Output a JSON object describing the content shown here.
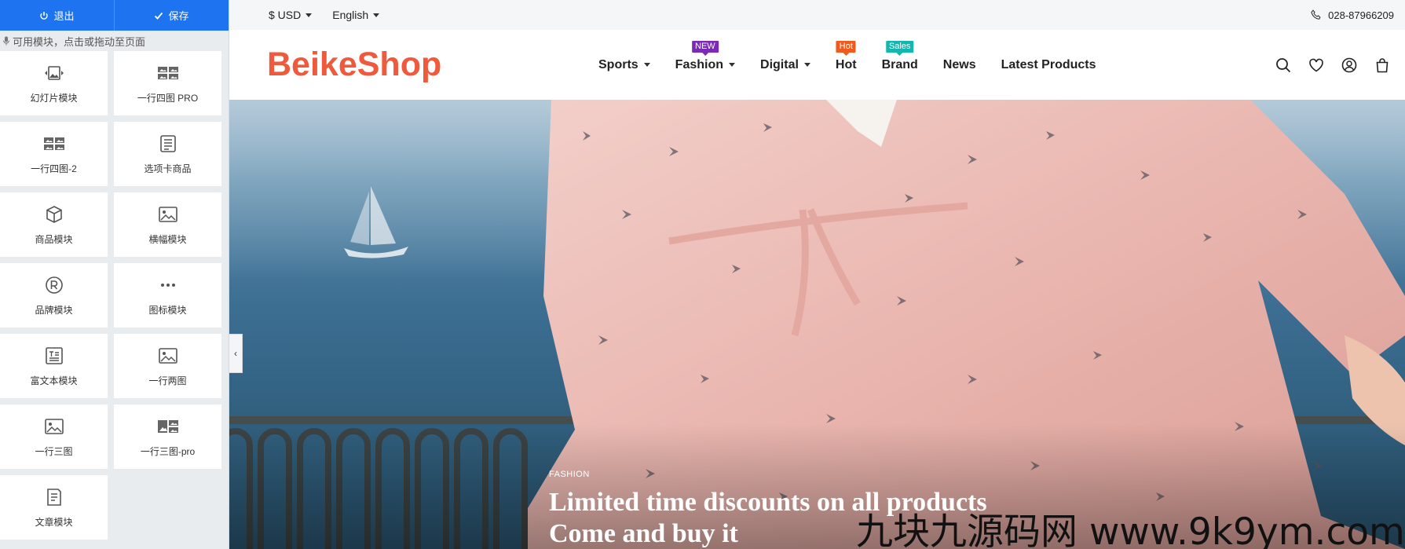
{
  "editor": {
    "exit_label": "退出",
    "save_label": "保存",
    "hint": "可用模块，点击或拖动至页面",
    "modules": [
      {
        "label": "幻灯片模块",
        "icon": "slideshow-icon"
      },
      {
        "label": "一行四图 PRO",
        "icon": "four-images-icon"
      },
      {
        "label": "一行四图-2",
        "icon": "four-images-icon"
      },
      {
        "label": "选项卡商品",
        "icon": "tab-products-icon"
      },
      {
        "label": "商品模块",
        "icon": "product-box-icon"
      },
      {
        "label": "横幅模块",
        "icon": "banner-image-icon"
      },
      {
        "label": "品牌模块",
        "icon": "registered-brand-icon"
      },
      {
        "label": "图标模块",
        "icon": "more-dots-icon"
      },
      {
        "label": "富文本模块",
        "icon": "rich-text-icon"
      },
      {
        "label": "一行两图",
        "icon": "image-icon"
      },
      {
        "label": "一行三图",
        "icon": "image-icon"
      },
      {
        "label": "一行三图-pro",
        "icon": "three-images-icon"
      },
      {
        "label": "文章模块",
        "icon": "article-icon"
      }
    ],
    "collapse_glyph": "‹"
  },
  "topbar": {
    "currency": "$ USD",
    "language": "English",
    "phone": "028-87966209"
  },
  "header": {
    "logo": "BeikeShop",
    "nav": [
      {
        "label": "Sports",
        "dropdown": true,
        "badge": null
      },
      {
        "label": "Fashion",
        "dropdown": true,
        "badge": "NEW",
        "badge_color": "#7b2ab8"
      },
      {
        "label": "Digital",
        "dropdown": true,
        "badge": null
      },
      {
        "label": "Hot",
        "dropdown": false,
        "badge": "Hot",
        "badge_color": "#f05a1c"
      },
      {
        "label": "Brand",
        "dropdown": false,
        "badge": "Sales",
        "badge_color": "#12b8b0"
      },
      {
        "label": "News",
        "dropdown": false,
        "badge": null
      },
      {
        "label": "Latest Products",
        "dropdown": false,
        "badge": null
      }
    ],
    "icons": [
      "search-icon",
      "heart-icon",
      "account-icon",
      "cart-icon"
    ]
  },
  "hero": {
    "kicker": "FASHION",
    "title_line1": "Limited time discounts on all products",
    "title_line2": "Come and buy it"
  },
  "watermark": "九块九源码网 www.9k9ym.com",
  "colors": {
    "accent": "#1e74f0",
    "logo": "#f05a3c"
  }
}
